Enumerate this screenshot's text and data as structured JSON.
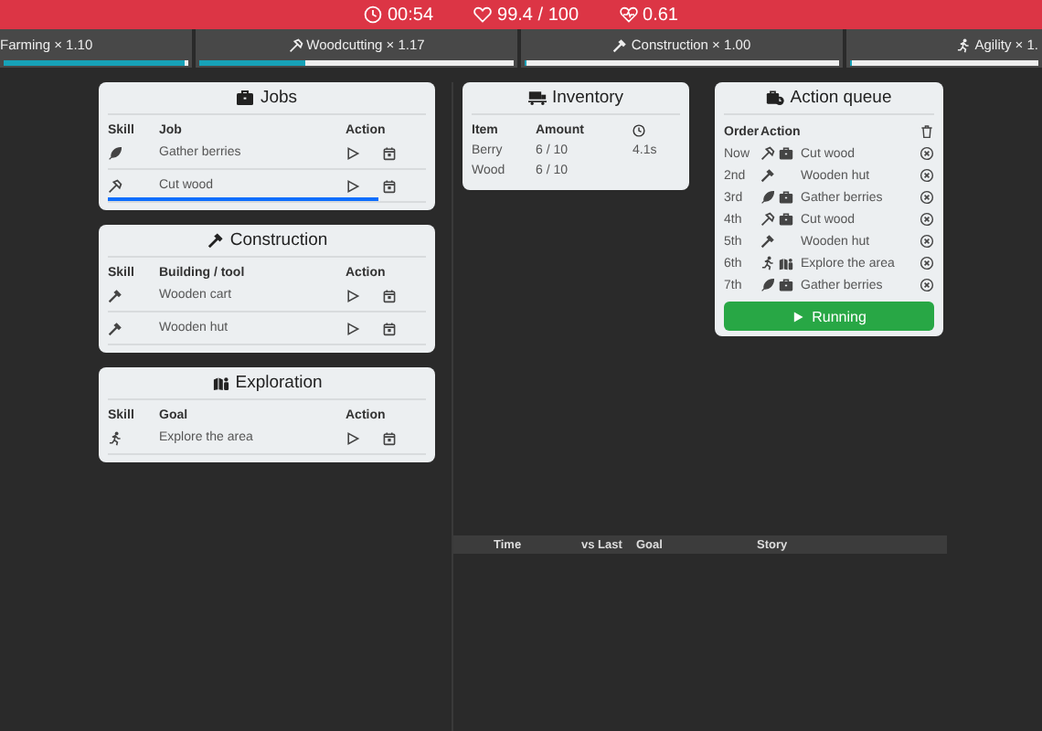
{
  "status": {
    "time": "00:54",
    "health": "99.4 / 100",
    "rate": "0.61"
  },
  "skills": [
    {
      "label": "Farming × 1.10",
      "level": 0.97
    },
    {
      "kind": "woodcutting",
      "label": "Woodcutting × 1.17",
      "level": 0.33
    },
    {
      "kind": "construction",
      "label": "Construction × 1.00",
      "level": 0
    },
    {
      "kind": "agility",
      "label": "Agility × 1.",
      "level": 0
    }
  ],
  "panels": [
    {
      "kind": "jobs",
      "title": "Jobs",
      "columns": [
        "Skill",
        "Job",
        "Action"
      ],
      "rows": [
        {
          "kind": "farming",
          "label": "Gather berries"
        },
        {
          "kind": "woodcutting",
          "label": "Cut wood",
          "level": 0.85
        }
      ]
    },
    {
      "kind": "construction",
      "title": "Construction",
      "columns": [
        "Skill",
        "Building / tool",
        "Action"
      ],
      "rows": [
        {
          "kind": "construction",
          "label": "Wooden cart"
        },
        {
          "kind": "construction",
          "label": "Wooden hut"
        }
      ]
    },
    {
      "kind": "exploration",
      "title": "Exploration",
      "columns": [
        "Skill",
        "Goal",
        "Action"
      ],
      "rows": [
        {
          "kind": "agility",
          "label": "Explore the area"
        }
      ]
    }
  ],
  "inventory": {
    "title": "Inventory",
    "columns": [
      "Item",
      "Amount"
    ],
    "rows": [
      {
        "item": "Berry",
        "amount": "6 / 10",
        "time": "4.1s"
      },
      {
        "item": "Wood",
        "amount": "6 / 10"
      }
    ]
  },
  "queue": {
    "title": "Action queue",
    "columns": [
      "Order",
      "Action"
    ],
    "rows": [
      {
        "order": "Now",
        "kind": "woodcutting",
        "category": {
          "kind": "jobs"
        },
        "label": "Cut wood"
      },
      {
        "order": "2nd",
        "kind": "construction",
        "label": "Wooden hut"
      },
      {
        "order": "3rd",
        "kind": "farming",
        "category": {
          "kind": "jobs"
        },
        "label": "Gather berries"
      },
      {
        "order": "4th",
        "kind": "woodcutting",
        "category": {
          "kind": "jobs"
        },
        "label": "Cut wood"
      },
      {
        "order": "5th",
        "kind": "construction",
        "label": "Wooden hut"
      },
      {
        "order": "6th",
        "kind": "agility",
        "category": {
          "kind": "exploration"
        },
        "label": "Explore the area"
      },
      {
        "order": "7th",
        "kind": "farming",
        "category": {
          "kind": "jobs"
        },
        "label": "Gather berries"
      }
    ],
    "button": "Running"
  },
  "story": {
    "columns": [
      "Time",
      "vs Last",
      "Goal",
      "Story"
    ]
  }
}
